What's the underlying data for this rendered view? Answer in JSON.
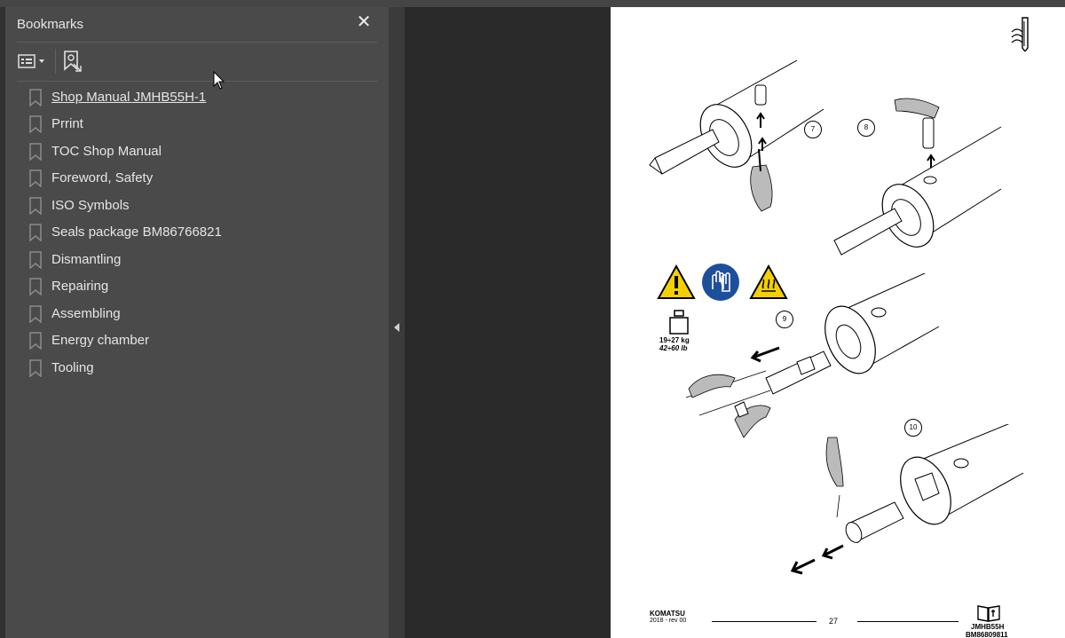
{
  "sidebar": {
    "title": "Bookmarks",
    "close_icon": "close-icon",
    "toolbar": {
      "options_icon": "list-options-icon",
      "add_bookmark_icon": "add-bookmark-icon"
    },
    "items": [
      {
        "label": "Shop Manual JMHB55H-1",
        "active": true
      },
      {
        "label": "Prrint"
      },
      {
        "label": "TOC Shop Manual"
      },
      {
        "label": "Foreword, Safety"
      },
      {
        "label": "ISO Symbols"
      },
      {
        "label": "Seals package BM86766821"
      },
      {
        "label": "Dismantling"
      },
      {
        "label": "Repairing"
      },
      {
        "label": "Assembling"
      },
      {
        "label": "Energy chamber"
      },
      {
        "label": "Tooling"
      }
    ]
  },
  "document_page": {
    "steps": [
      "7",
      "8",
      "9",
      "10"
    ],
    "weight_line1": "19÷27 kg",
    "weight_line2": "42÷60 lb",
    "footer": {
      "brand": "KOMATSU",
      "revision": "2018 -  rev 00",
      "page_number": "27",
      "model": "JMHB55H",
      "code": "BM86809811"
    },
    "safety_icons": [
      "warning-triangle-icon",
      "gloves-mandatory-icon",
      "hot-surface-icon"
    ]
  },
  "colors": {
    "panel_bg": "#4a4a4a",
    "viewer_bg": "#2a2a2a",
    "text": "#e6e6e6",
    "warning_yellow": "#f5d000",
    "mandatory_blue": "#1e4f9c"
  }
}
